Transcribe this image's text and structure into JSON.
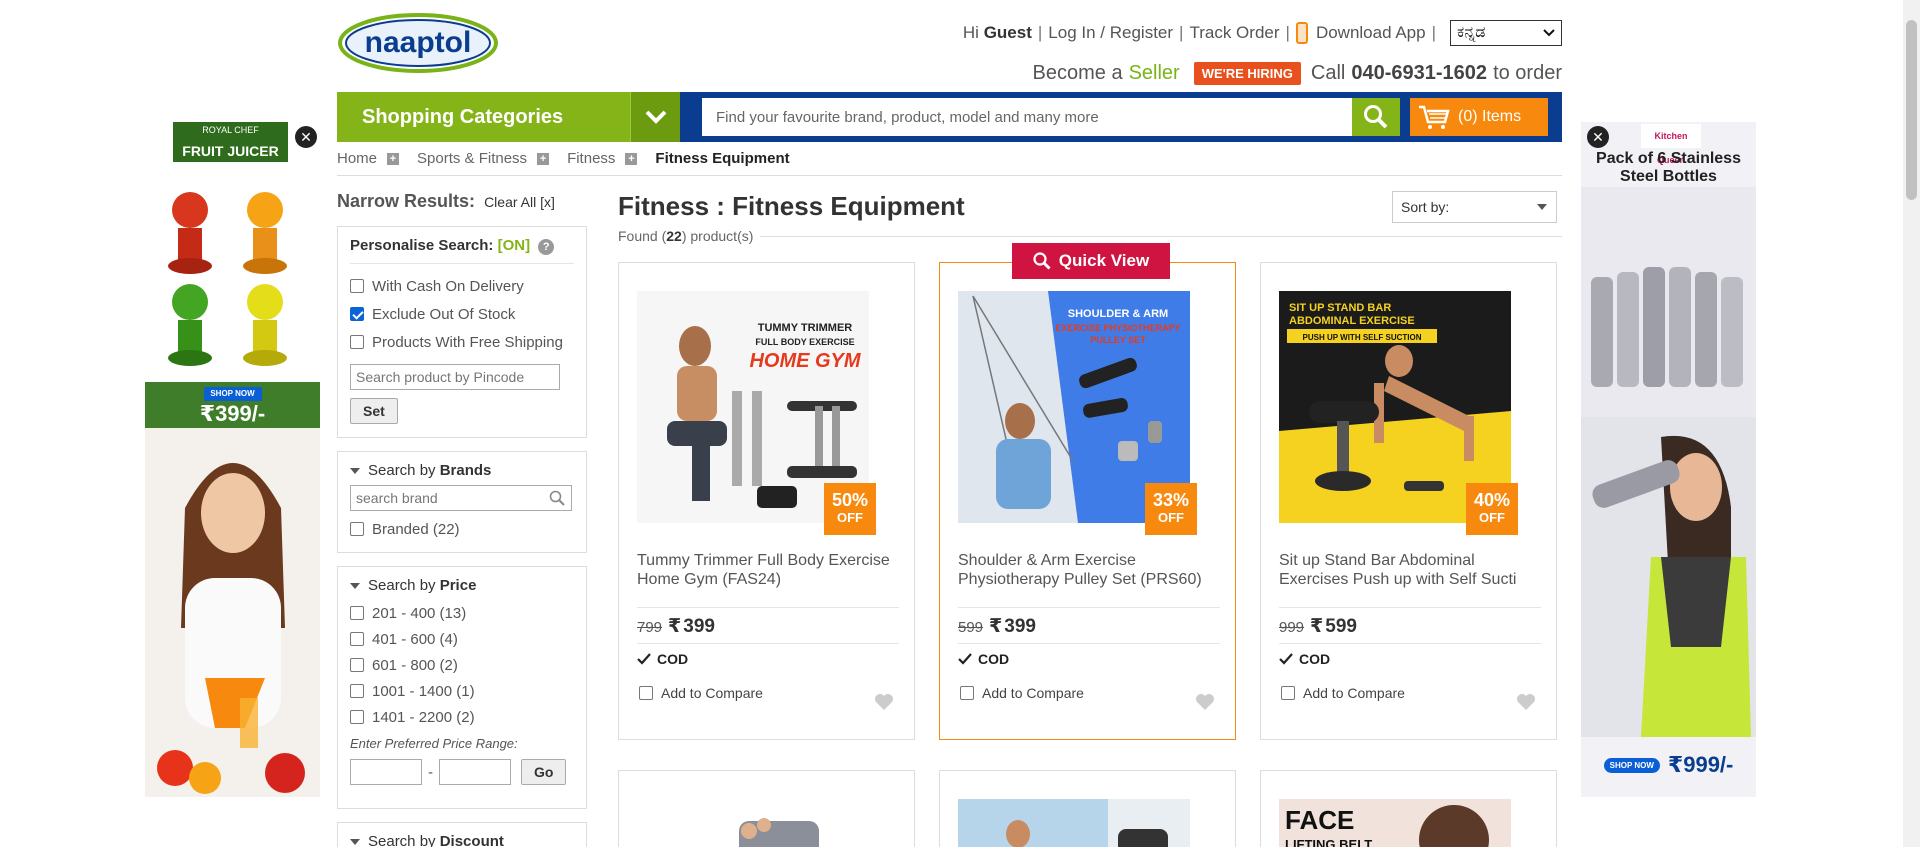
{
  "brand": {
    "logo_text": "naaptol"
  },
  "toplinks": {
    "greeting_prefix": "Hi",
    "guest": "Guest",
    "login": "Log In / Register",
    "track": "Track Order",
    "download": "Download App",
    "language": "ಕನ್ನಡ"
  },
  "promo": {
    "become": "Become a",
    "seller": "Seller",
    "hiring": "WE'RE HIRING",
    "call": "Call",
    "phone": "040-6931-1602",
    "to_order": "to order"
  },
  "nav": {
    "categories": "Shopping Categories",
    "search_placeholder": "Find your favourite brand, product, model and many more",
    "cart": "(0) Items"
  },
  "breadcrumb": [
    "Home",
    "Sports & Fitness",
    "Fitness",
    "Fitness Equipment"
  ],
  "filters": {
    "narrow": "Narrow Results:",
    "clear": "Clear All [x]",
    "personalise_label": "Personalise Search:",
    "personalise_state": "[ON]",
    "options": [
      {
        "label": "With Cash On Delivery",
        "checked": false
      },
      {
        "label": "Exclude Out Of Stock",
        "checked": true
      },
      {
        "label": "Products With Free Shipping",
        "checked": false
      }
    ],
    "pincode_placeholder": "Search product by Pincode",
    "set_button": "Set",
    "brands_prefix": "Search by",
    "brands_title": "Brands",
    "brand_placeholder": "search brand",
    "brand_options": [
      "Branded (22)"
    ],
    "price_prefix": "Search by",
    "price_title": "Price",
    "price_options": [
      "201 - 400 (13)",
      "401 - 600 (4)",
      "601 - 800 (2)",
      "1001 - 1400 (1)",
      "1401 - 2200 (2)"
    ],
    "price_range_label": "Enter Preferred Price Range:",
    "range_dash": "-",
    "go_button": "Go",
    "discount_prefix": "Search by",
    "discount_title": "Discount"
  },
  "listing": {
    "title": "Fitness : Fitness Equipment",
    "found_prefix": "Found (",
    "found_count": "22",
    "found_suffix": ") product(s)",
    "sort_label": "Sort by:",
    "quick_view": "Quick View",
    "cod_label": "COD",
    "compare_label": "Add to Compare",
    "off_label": "OFF",
    "products": [
      {
        "name": "Tummy Trimmer Full Body Exercise Home Gym (FAS24)",
        "mrp": "799",
        "price": "399",
        "discount": "50%",
        "img_text_1": "TUMMY TRIMMER",
        "img_text_2": "FULL BODY EXERCISE",
        "img_text_3": "HOME GYM"
      },
      {
        "name": "Shoulder & Arm Exercise Physiotherapy Pulley Set (PRS60)",
        "mrp": "599",
        "price": "399",
        "discount": "33%",
        "img_text_1": "SHOULDER & ARM",
        "img_text_2": "EXERCISE PHYSIOTHERAPY",
        "img_text_3": "PULLEY SET"
      },
      {
        "name": "Sit up Stand Bar Abdominal Exercises Push up with Self Sucti",
        "mrp": "999",
        "price": "599",
        "discount": "40%",
        "img_text_1": "SIT UP STAND BAR",
        "img_text_2": "ABDOMINAL EXERCISE",
        "img_text_3": "PUSH UP WITH SELF SUCTION"
      }
    ],
    "row2_texts": [
      "FACE",
      "LIFTING BELT"
    ]
  },
  "ads": {
    "left_brand": "ROYAL CHEF",
    "left_title": "FRUIT JUICER",
    "left_shop": "SHOP NOW",
    "left_price": "₹399/-",
    "right_brand": "Kitchen Queen",
    "right_title": "Pack of 6 Stainless Steel Bottles",
    "right_shop": "SHOP NOW",
    "right_price": "₹999/-"
  },
  "colors": {
    "green": "#84b418",
    "blue": "#0a3d8f",
    "orange": "#f78a0e",
    "red": "#cf1441"
  }
}
